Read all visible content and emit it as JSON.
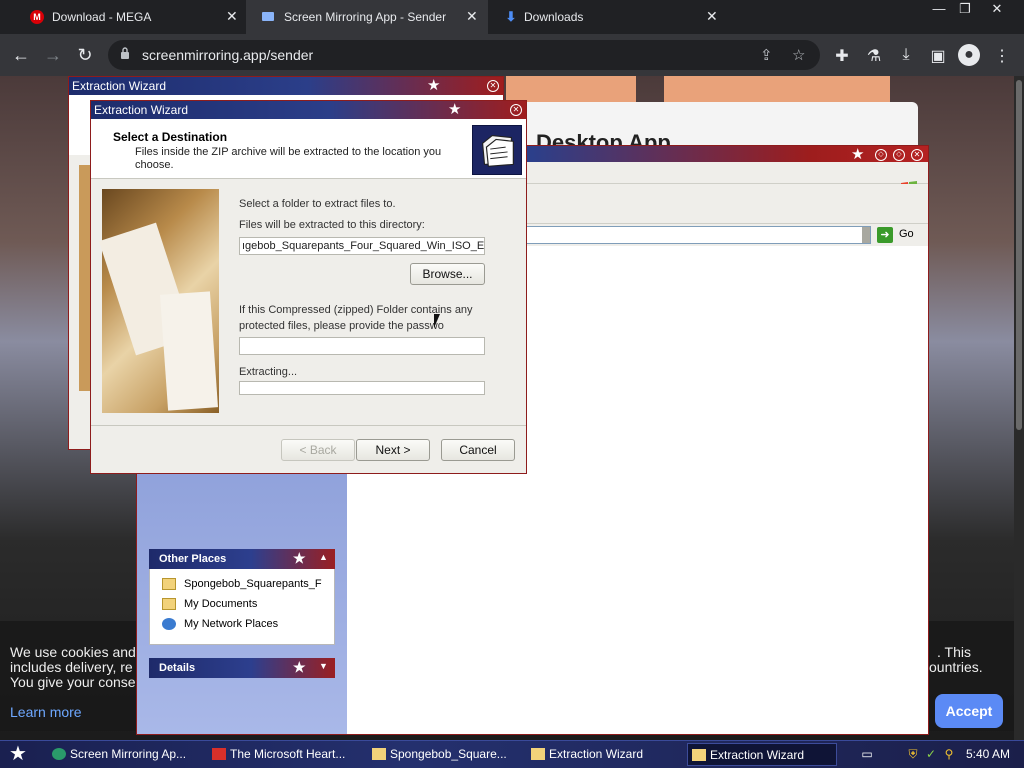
{
  "browser": {
    "tabs": [
      {
        "label": "Download - MEGA",
        "favicon": "M",
        "favicon_color": "#d90007"
      },
      {
        "label": "Screen Mirroring App - Sender",
        "favicon": "",
        "favicon_color": "#8ab4f8"
      },
      {
        "label": "Downloads",
        "favicon": "",
        "favicon_color": "#4d8df6"
      }
    ],
    "url": "screenmirroring.app/sender"
  },
  "background_page": {
    "heading": "Desktop App"
  },
  "explorer": {
    "go_label": "Go",
    "other_places": {
      "title": "Other Places",
      "items": [
        {
          "label": "Spongebob_Squarepants_F"
        },
        {
          "label": "My Documents"
        },
        {
          "label": "My Network Places"
        }
      ]
    },
    "details": {
      "title": "Details"
    }
  },
  "wizard_back": {
    "title": "Extraction Wizard"
  },
  "wizard": {
    "title": "Extraction Wizard",
    "header_title": "Select a Destination",
    "header_subtitle": "Files inside the ZIP archive will be extracted to the location you choose.",
    "select_folder_text": "Select a folder to extract files to.",
    "directory_label": "Files will be extracted to this directory:",
    "directory_value": "ıgebob_Squarepants_Four_Squared_Win_ISO_EN",
    "browse_label": "Browse...",
    "password_text_1": "If this Compressed (zipped) Folder contains any",
    "password_text_2": "protected files, please provide the passwo",
    "password_value": "",
    "extracting_label": "Extracting...",
    "progress": 0,
    "back_label": "< Back",
    "next_label": "Next >",
    "cancel_label": "Cancel"
  },
  "cookie_banner": {
    "left_lines": [
      "We use cookies and",
      "includes delivery, re",
      "You give your conse"
    ],
    "right_lines": [
      ". This",
      "ountries."
    ],
    "learn_more": "Learn more",
    "accept": "Accept"
  },
  "taskbar": {
    "items": [
      {
        "label": "Screen Mirroring Ap..."
      },
      {
        "label": "The Microsoft Heart..."
      },
      {
        "label": "Spongebob_Square..."
      },
      {
        "label": "Extraction Wizard"
      },
      {
        "label": "Extraction Wizard"
      }
    ],
    "clock": "5:40 AM"
  },
  "colors": {
    "xp_blue": "#1d2c6c",
    "xp_red": "#a01d1d",
    "accept_blue": "#5b8af5",
    "chrome_dark": "#202124"
  }
}
